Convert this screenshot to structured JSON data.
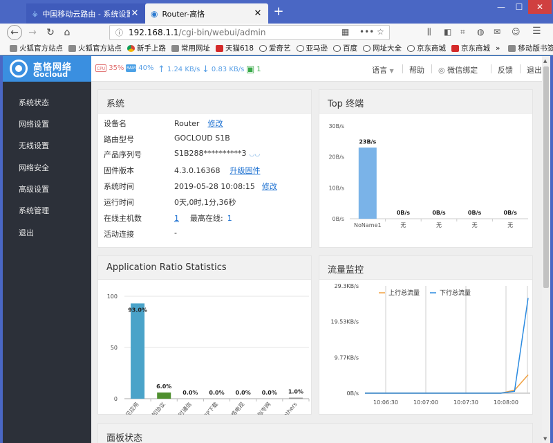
{
  "browser": {
    "tabs": [
      {
        "label": "中国移动云路由 - 系统设置",
        "icon": "router-signal-icon"
      },
      {
        "label": "Router-高恪",
        "icon": "globe-icon"
      }
    ],
    "url_host": "192.168.1.1",
    "url_path": "/cgi-bin/webui/admin",
    "bookmarks": [
      "火狐官方站点",
      "火狐官方站点",
      "新手上路",
      "常用网址",
      "天猫618",
      "爱奇艺",
      "亚马逊",
      "百度",
      "网址大全",
      "京东商城",
      "京东商城",
      "移动版书签"
    ]
  },
  "logo": {
    "cn": "高恪网络",
    "en": "Gocloud"
  },
  "status": {
    "cpu_chip": "CPU",
    "cpu": "35%",
    "ram_chip": "RAM",
    "ram": "40%",
    "up": "1.24 KB/s",
    "down": "0.83 KB/s",
    "devices": "1"
  },
  "topnav": [
    "语言",
    "帮助",
    "微信绑定",
    "反馈",
    "退出"
  ],
  "sidebar": [
    "系统状态",
    "网络设置",
    "无线设置",
    "网络安全",
    "高级设置",
    "系统管理",
    "退出"
  ],
  "system": {
    "title": "系统",
    "rows": [
      {
        "label": "设备名",
        "value": "Router",
        "link": "修改"
      },
      {
        "label": "路由型号",
        "value": "GOCLOUD S1B"
      },
      {
        "label": "产品序列号",
        "value": "S1B288**********3"
      },
      {
        "label": "固件版本",
        "value": "4.3.0.16368",
        "link": "升级固件"
      },
      {
        "label": "系统时间",
        "value": "2019-05-28 10:08:15",
        "link": "修改"
      },
      {
        "label": "运行时间",
        "value": "0天,0时,1分,36秒"
      },
      {
        "label": "在线主机数",
        "value": "1",
        "extra_label": "最高在线:",
        "extra_value": "1"
      },
      {
        "label": "活动连接",
        "value": "-"
      }
    ]
  },
  "top_terminals": {
    "title": "Top 终端",
    "chart_data": {
      "type": "bar",
      "categories": [
        "NoName1",
        "无",
        "无",
        "无",
        "无"
      ],
      "values": [
        23,
        0,
        0,
        0,
        0
      ],
      "value_labels": [
        "23B/s",
        "0B/s",
        "0B/s",
        "0B/s",
        "0B/s"
      ],
      "yticks": [
        "30B/s",
        "20B/s",
        "10B/s",
        "0B/s"
      ],
      "ylim": [
        0,
        30
      ]
    }
  },
  "app_ratio": {
    "title": "Application Ratio Statistics",
    "chart_data": {
      "type": "bar",
      "categories": [
        "常见应用",
        "未知协议",
        "即时通信",
        "P2P下载",
        "网络电视",
        "虚拟专网",
        "others"
      ],
      "values": [
        93.0,
        6.0,
        0.0,
        0.0,
        0.0,
        0.0,
        1.0
      ],
      "value_labels": [
        "93.0%",
        "6.0%",
        "0.0%",
        "0.0%",
        "0.0%",
        "0.0%",
        "1.0%"
      ],
      "colors": [
        "#4aa3c9",
        "#4f8f2f",
        "#999999",
        "#999999",
        "#999999",
        "#999999",
        "#999999"
      ],
      "yticks": [
        "100",
        "50",
        "0"
      ],
      "ylim": [
        0,
        100
      ]
    }
  },
  "traffic": {
    "title": "流量监控",
    "chart_data": {
      "type": "line",
      "yticks": [
        "29.3KB/s",
        "19.53KB/s",
        "9.77KB/s",
        "0B/s"
      ],
      "xticks": [
        "10:06:30",
        "10:07:00",
        "10:07:30",
        "10:08:00"
      ],
      "ylim": [
        0,
        29.3
      ],
      "series": [
        {
          "name": "上行总流量",
          "color": "#f0a040",
          "values": [
            0,
            0,
            0,
            0,
            0,
            0,
            0,
            0,
            0,
            0,
            0,
            0.8,
            5.0
          ]
        },
        {
          "name": "下行总流量",
          "color": "#2a8ae0",
          "values": [
            0,
            0,
            0,
            0,
            0,
            0,
            0,
            0,
            0,
            0,
            0,
            0.5,
            26.0
          ]
        }
      ]
    }
  },
  "panel_status": {
    "title": "面板状态"
  }
}
